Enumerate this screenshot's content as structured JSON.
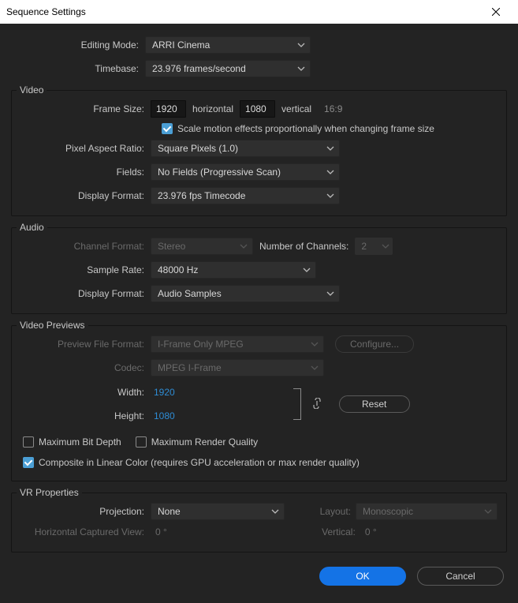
{
  "dialog": {
    "title": "Sequence Settings"
  },
  "general": {
    "editing_mode_label": "Editing Mode:",
    "editing_mode_value": "ARRI Cinema",
    "timebase_label": "Timebase:",
    "timebase_value": "23.976  frames/second"
  },
  "video": {
    "group_title": "Video",
    "frame_size_label": "Frame Size:",
    "frame_width": "1920",
    "horizontal_label": "horizontal",
    "frame_height": "1080",
    "vertical_label": "vertical",
    "aspect_text": "16:9",
    "scale_motion_label": "Scale motion effects proportionally when changing frame size",
    "par_label": "Pixel Aspect Ratio:",
    "par_value": "Square Pixels (1.0)",
    "fields_label": "Fields:",
    "fields_value": "No Fields (Progressive Scan)",
    "display_format_label": "Display Format:",
    "display_format_value": "23.976 fps Timecode"
  },
  "audio": {
    "group_title": "Audio",
    "channel_format_label": "Channel Format:",
    "channel_format_value": "Stereo",
    "num_channels_label": "Number of Channels:",
    "num_channels_value": "2",
    "sample_rate_label": "Sample Rate:",
    "sample_rate_value": "48000 Hz",
    "display_format_label": "Display Format:",
    "display_format_value": "Audio Samples"
  },
  "previews": {
    "group_title": "Video Previews",
    "file_format_label": "Preview File Format:",
    "file_format_value": "I-Frame Only MPEG",
    "configure_label": "Configure...",
    "codec_label": "Codec:",
    "codec_value": "MPEG I-Frame",
    "width_label": "Width:",
    "width_value": "1920",
    "height_label": "Height:",
    "height_value": "1080",
    "reset_label": "Reset",
    "max_bit_depth_label": "Maximum Bit Depth",
    "max_render_quality_label": "Maximum Render Quality",
    "composite_label": "Composite in Linear Color (requires GPU acceleration or max render quality)"
  },
  "vr": {
    "group_title": "VR Properties",
    "projection_label": "Projection:",
    "projection_value": "None",
    "layout_label": "Layout:",
    "layout_value": "Monoscopic",
    "hcv_label": "Horizontal Captured View:",
    "hcv_value": "0 °",
    "vertical_label": "Vertical:",
    "vertical_value": "0 °"
  },
  "footer": {
    "ok_label": "OK",
    "cancel_label": "Cancel"
  }
}
